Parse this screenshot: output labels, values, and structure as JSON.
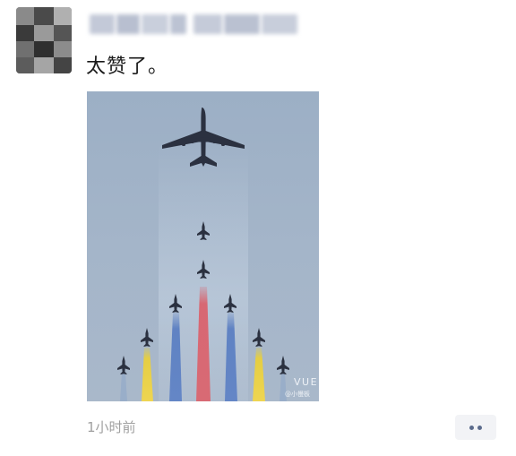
{
  "post": {
    "author_name": "",
    "text": "太赞了。",
    "timestamp": "1小时前"
  },
  "image": {
    "watermark_main": "VUE",
    "watermark_sub": "@小慢板",
    "smoke_colors": {
      "red": "#d9636e",
      "blue": "#5b7fc2",
      "yellow": "#e8cf3c"
    },
    "sky_color": "#9fb1c6"
  },
  "more_button": {
    "icon": "more-dots-icon"
  }
}
